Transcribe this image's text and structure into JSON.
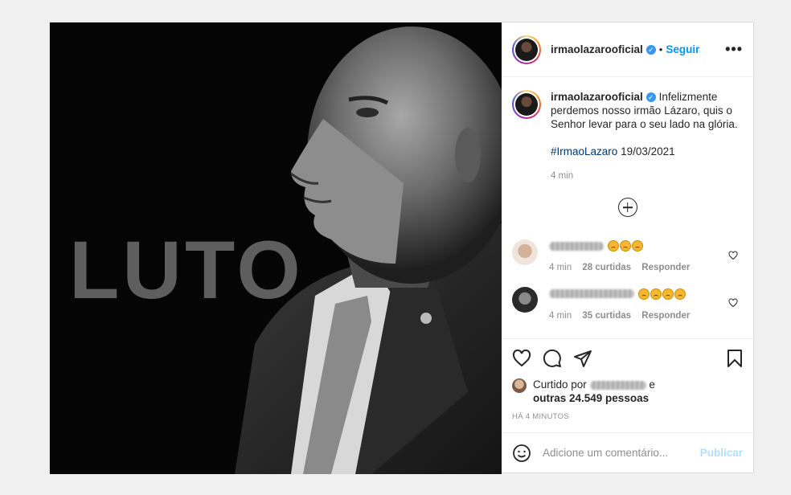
{
  "post": {
    "image_text": "LUTO",
    "header": {
      "username": "irmaolazarooficial",
      "dot": "•",
      "follow_label": "Seguir",
      "more_label": "•••"
    },
    "caption": {
      "username": "irmaolazarooficial",
      "text": "Infelizmente perdemos nosso irmão Lázaro, quis o Senhor levar para o seu lado na glória.",
      "hashtag": "#IrmaoLazaro",
      "date": "19/03/2021",
      "time": "4 min"
    },
    "comments": [
      {
        "time": "4 min",
        "likes": "28 curtidas",
        "reply": "Responder"
      },
      {
        "time": "4 min",
        "likes": "35 curtidas",
        "reply": "Responder"
      }
    ],
    "likes": {
      "prefix": "Curtido por",
      "conj": "e",
      "others": "outras 24.549 pessoas"
    },
    "posted_ago": "HÁ 4 MINUTOS",
    "add_comment": {
      "placeholder": "Adicione um comentário...",
      "publish_label": "Publicar"
    }
  },
  "colors": {
    "accent": "#0095f6",
    "verified": "#3897f0",
    "publish_disabled": "#b2dffc",
    "muted": "#8e8e8e"
  },
  "icons": [
    "heart-icon",
    "comment-icon",
    "share-icon",
    "bookmark-icon",
    "emoji-icon",
    "plus-circle-icon",
    "verified-icon",
    "more-options-icon"
  ]
}
